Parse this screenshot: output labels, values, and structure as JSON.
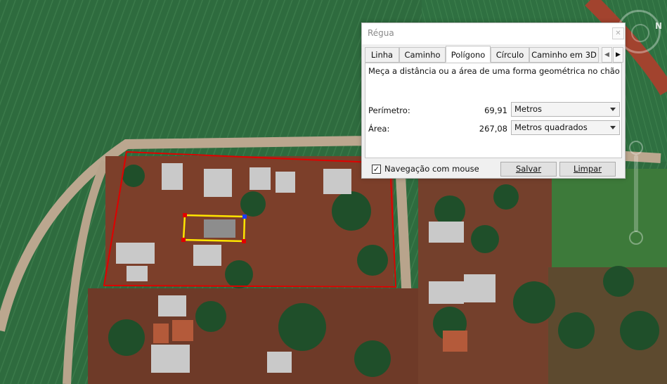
{
  "dialog": {
    "title": "Régua",
    "close_glyph": "✕",
    "tabs": [
      {
        "label": "Linha"
      },
      {
        "label": "Caminho"
      },
      {
        "label": "Polígono",
        "active": true
      },
      {
        "label": "Círculo"
      },
      {
        "label": "Caminho em 3D"
      }
    ],
    "description": "Meça a distância ou a área de uma forma geométrica no chão",
    "perimeter": {
      "label": "Perímetro:",
      "value": "69,91",
      "unit": "Metros"
    },
    "area": {
      "label": "Área:",
      "value": "267,08",
      "unit": "Metros quadrados"
    },
    "mouse_navigation": {
      "checked": true,
      "check_glyph": "✓",
      "label": "Navegação com mouse"
    },
    "save_label": "Salvar",
    "clear_label": "Limpar"
  },
  "map": {
    "north_glyph": "N",
    "outline_color": "#e00000",
    "polygon_color": "#ffe500",
    "vertex_color": "#e00000",
    "active_vertex_color": "#1a3cff"
  },
  "icons": {
    "tab_left": "chevron-left-icon",
    "tab_right": "chevron-right-icon",
    "dropdown": "chevron-down-icon",
    "compass": "compass-icon"
  },
  "colors": {
    "dialog_bg": "#f0f0f0",
    "panel_bg": "#ffffff",
    "field_green": "#2f6a3c",
    "soil_red": "#7a3c28",
    "road": "#b9a58e"
  }
}
